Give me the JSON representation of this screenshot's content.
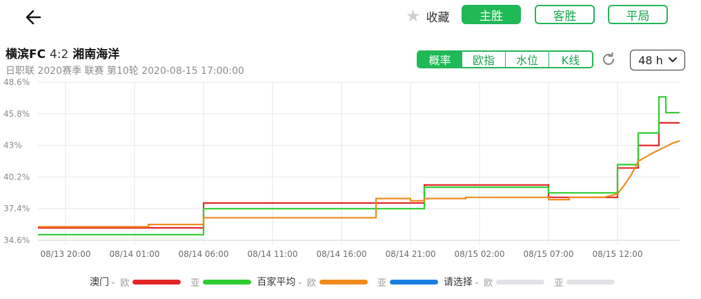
{
  "top": {
    "favorite_label": "收藏",
    "tabs": [
      {
        "label": "主胜",
        "active": true
      },
      {
        "label": "客胜",
        "active": false
      },
      {
        "label": "平局",
        "active": false
      }
    ]
  },
  "match": {
    "home": "横滨FC",
    "score": "4:2",
    "away": "湘南海洋",
    "meta": "日职联 2020赛季 联赛 第10轮 2020-08-15 17:00:00"
  },
  "segmented": [
    {
      "label": "概率",
      "active": true
    },
    {
      "label": "欧指",
      "active": false
    },
    {
      "label": "水位",
      "active": false
    },
    {
      "label": "K线",
      "active": false
    }
  ],
  "time_range": "48 h",
  "colors": {
    "accent": "#1fba55",
    "red": "#e3262a",
    "green": "#2fcc2f",
    "orange": "#f08a1c",
    "blue": "#1b7fe0",
    "gray": "#e1e1e6"
  },
  "chart_data": {
    "type": "line",
    "y_unit": "%",
    "ylim": [
      34.6,
      48.6
    ],
    "y_ticks": [
      "48.6%",
      "45.8%",
      "43%",
      "40.2%",
      "37.4%",
      "34.6%"
    ],
    "x_ticks": [
      "08/13 20:00",
      "08/14 01:00",
      "08/14 06:00",
      "08/14 11:00",
      "08/14 16:00",
      "08/14 21:00",
      "08/15 02:00",
      "08/15 07:00",
      "08/15 12:00"
    ],
    "series": [
      {
        "name": "澳门",
        "market": "欧",
        "color": "#e3262a",
        "points": [
          [
            "08/13 18:00",
            35.7
          ],
          [
            "08/14 06:00",
            35.7
          ],
          [
            "08/14 06:00",
            37.9
          ],
          [
            "08/14 22:00",
            37.9
          ],
          [
            "08/14 22:00",
            39.5
          ],
          [
            "08/15 07:00",
            39.5
          ],
          [
            "08/15 07:00",
            38.4
          ],
          [
            "08/15 12:00",
            38.4
          ],
          [
            "08/15 12:00",
            41.0
          ],
          [
            "08/15 13:30",
            41.0
          ],
          [
            "08/15 13:30",
            43.0
          ],
          [
            "08/15 15:00",
            43.0
          ],
          [
            "08/15 15:00",
            45.0
          ],
          [
            "08/15 16:30",
            45.0
          ]
        ]
      },
      {
        "name": "澳门",
        "market": "亚",
        "color": "#2fcc2f",
        "points": [
          [
            "08/13 18:00",
            35.1
          ],
          [
            "08/14 06:00",
            35.1
          ],
          [
            "08/14 06:00",
            37.4
          ],
          [
            "08/14 22:00",
            37.4
          ],
          [
            "08/14 22:00",
            39.3
          ],
          [
            "08/15 07:00",
            39.3
          ],
          [
            "08/15 07:00",
            38.8
          ],
          [
            "08/15 12:00",
            38.8
          ],
          [
            "08/15 12:00",
            41.3
          ],
          [
            "08/15 13:30",
            41.3
          ],
          [
            "08/15 13:30",
            44.1
          ],
          [
            "08/15 15:00",
            44.1
          ],
          [
            "08/15 15:00",
            47.3
          ],
          [
            "08/15 15:30",
            47.3
          ],
          [
            "08/15 15:30",
            45.9
          ],
          [
            "08/15 16:30",
            45.9
          ]
        ]
      },
      {
        "name": "百家平均",
        "market": "欧",
        "color": "#f08a1c",
        "points": [
          [
            "08/13 18:00",
            35.8
          ],
          [
            "08/14 02:00",
            35.8
          ],
          [
            "08/14 02:00",
            36.0
          ],
          [
            "08/14 06:00",
            36.0
          ],
          [
            "08/14 06:00",
            36.6
          ],
          [
            "08/14 18:30",
            36.6
          ],
          [
            "08/14 18:30",
            38.3
          ],
          [
            "08/14 21:00",
            38.3
          ],
          [
            "08/14 21:00",
            38.1
          ],
          [
            "08/14 22:00",
            38.1
          ],
          [
            "08/14 22:00",
            38.3
          ],
          [
            "08/15 01:00",
            38.3
          ],
          [
            "08/15 01:00",
            38.4
          ],
          [
            "08/15 07:00",
            38.4
          ],
          [
            "08/15 07:00",
            38.2
          ],
          [
            "08/15 08:30",
            38.2
          ],
          [
            "08/15 08:30",
            38.4
          ],
          [
            "08/15 11:00",
            38.4
          ],
          [
            "08/15 12:00",
            38.7
          ],
          [
            "08/15 12:30",
            39.5
          ],
          [
            "08/15 13:00",
            40.4
          ],
          [
            "08/15 13:30",
            41.6
          ],
          [
            "08/15 14:30",
            42.3
          ],
          [
            "08/15 15:30",
            42.9
          ],
          [
            "08/15 16:00",
            43.2
          ],
          [
            "08/15 16:30",
            43.4
          ]
        ]
      },
      {
        "name": "百家平均",
        "market": "亚",
        "color": "#1b7fe0",
        "points": []
      },
      {
        "name": "请选择",
        "market": "欧",
        "color": "#e1e1e6",
        "points": []
      },
      {
        "name": "请选择",
        "market": "亚",
        "color": "#e1e1e6",
        "points": []
      }
    ]
  },
  "legend": [
    {
      "name": "澳门",
      "dropdown": true,
      "sub1": "欧",
      "sub2": "亚"
    },
    {
      "name": "百家平均",
      "dropdown": true,
      "sub1": "欧",
      "sub2": "亚"
    },
    {
      "name": "请选择",
      "dropdown": true,
      "sub1": "欧",
      "sub2": "亚"
    }
  ]
}
